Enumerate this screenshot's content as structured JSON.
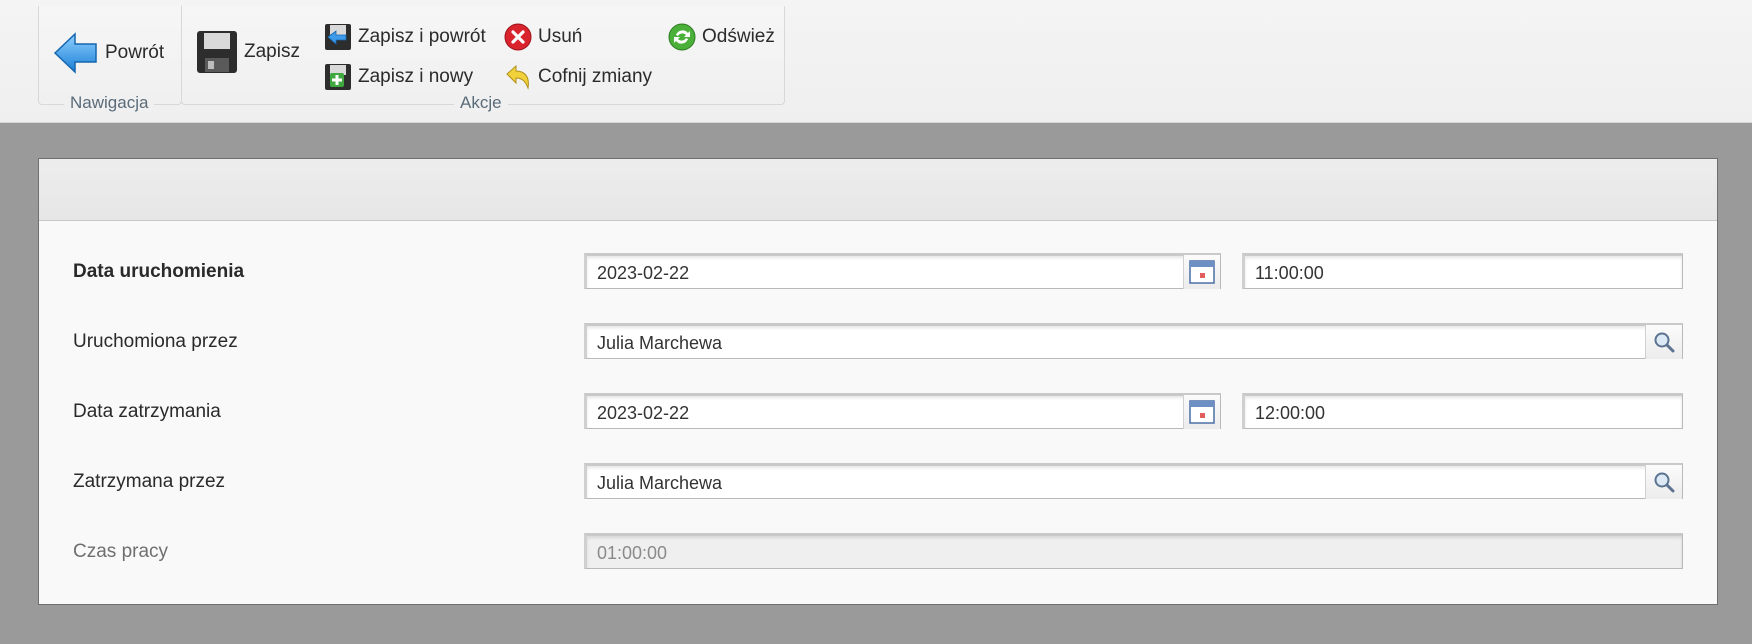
{
  "toolbar": {
    "back_label": "Powrót",
    "save_label": "Zapisz",
    "save_return_label": "Zapisz i powrót",
    "save_new_label": "Zapisz i nowy",
    "delete_label": "Usuń",
    "undo_label": "Cofnij zmiany",
    "refresh_label": "Odśwież",
    "group_nav_label": "Nawigacja",
    "group_actions_label": "Akcje"
  },
  "form": {
    "start_date_label": "Data uruchomienia",
    "start_date": "2023-02-22",
    "start_time": "11:00:00",
    "started_by_label": "Uruchomiona przez",
    "started_by": "Julia Marchewa",
    "stop_date_label": "Data zatrzymania",
    "stop_date": "2023-02-22",
    "stop_time": "12:00:00",
    "stopped_by_label": "Zatrzymana przez",
    "stopped_by": "Julia Marchewa",
    "work_time_label": "Czas pracy",
    "work_time": "01:00:00"
  },
  "icons": {
    "back": "arrow-left-icon",
    "save": "floppy-disk-icon",
    "save_return": "floppy-return-icon",
    "save_new": "floppy-plus-icon",
    "delete": "red-x-circle-icon",
    "undo": "undo-arrow-icon",
    "refresh": "refresh-icon",
    "calendar": "calendar-icon",
    "search": "magnifier-icon"
  }
}
